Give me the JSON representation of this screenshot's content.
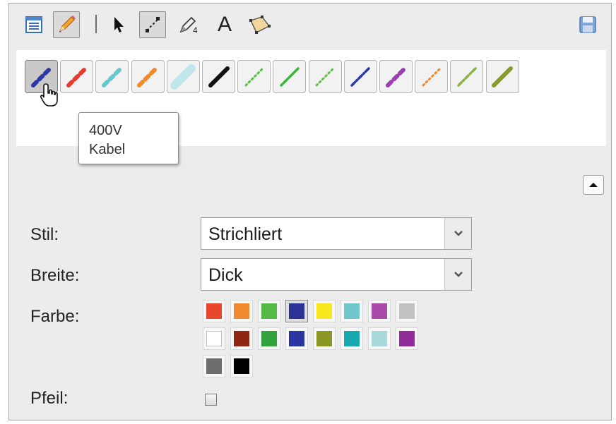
{
  "toolbar": {
    "tools": [
      {
        "icon": "table-icon"
      },
      {
        "icon": "pencil-icon",
        "active": true
      },
      {
        "icon": "pointer-icon"
      },
      {
        "icon": "line-points-icon",
        "active": true
      },
      {
        "icon": "pen-number-icon",
        "badge": "4"
      },
      {
        "icon": "text-icon",
        "label": "A"
      },
      {
        "icon": "polygon-icon"
      },
      {
        "icon": "save-icon"
      }
    ]
  },
  "pens": [
    {
      "color": "#2c38a8",
      "style": "dashed",
      "selected": true
    },
    {
      "color": "#e8392b",
      "style": "dashed"
    },
    {
      "color": "#65c8cc",
      "style": "dashed"
    },
    {
      "color": "#f18a2a",
      "style": "dashed"
    },
    {
      "color": "#bfe6ea",
      "style": "highlighter"
    },
    {
      "color": "#111111",
      "style": "solid"
    },
    {
      "color": "#55c041",
      "style": "dotted"
    },
    {
      "color": "#3fb33c",
      "style": "solid-thin"
    },
    {
      "color": "#5fbf4b",
      "style": "dotted"
    },
    {
      "color": "#2c38a8",
      "style": "dash-dot"
    },
    {
      "color": "#9c3fb5",
      "style": "dashed"
    },
    {
      "color": "#f18a2a",
      "style": "dotted"
    },
    {
      "color": "#8bb33a",
      "style": "dash-dot"
    },
    {
      "color": "#8a9a2a",
      "style": "solid"
    }
  ],
  "tooltip": {
    "line1": "400V",
    "line2": "Kabel"
  },
  "form": {
    "stil": {
      "label": "Stil:",
      "value": "Strichliert"
    },
    "breite": {
      "label": "Breite:",
      "value": "Dick"
    },
    "farbe": {
      "label": "Farbe:",
      "colors": [
        "#e8472b",
        "#f08a2c",
        "#55b947",
        "#2b3296",
        "#f8e61c",
        "#6fc7cc",
        "#a94aa8",
        "#c2c2c2",
        "#ffffff",
        "#8e2614",
        "#31a23c",
        "#2a36a0",
        "#8c9826",
        "#19a8ad",
        "#a7d9dc",
        "#8f2c96",
        "#6d6d6d",
        "#000000"
      ],
      "selected_index": 3
    },
    "pfeil": {
      "label": "Pfeil:",
      "checked": false
    }
  }
}
